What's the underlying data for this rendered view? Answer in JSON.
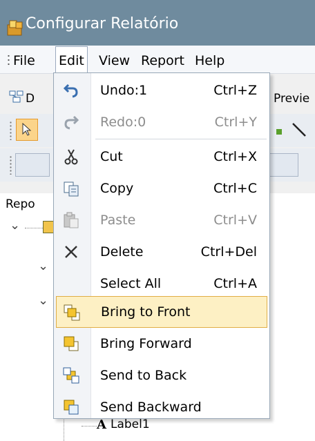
{
  "window": {
    "title": "Configurar Relatório",
    "title_icon": "report-config-icon"
  },
  "menubar": {
    "items": [
      {
        "label": "File"
      },
      {
        "label": "Edit"
      },
      {
        "label": "View"
      },
      {
        "label": "Report"
      },
      {
        "label": "Help"
      }
    ]
  },
  "toolbar": {
    "tab_partial_left": "D",
    "tab_partial_right": "Previe"
  },
  "tree": {
    "header_partial": "Repo",
    "bottom_item": "Label1"
  },
  "edit_menu": {
    "items": [
      {
        "label": "Undo:1",
        "shortcut": "Ctrl+Z",
        "icon": "undo-icon",
        "enabled": true
      },
      {
        "label": "Redo:0",
        "shortcut": "Ctrl+Y",
        "icon": "redo-icon",
        "enabled": false
      },
      {
        "label": "Cut",
        "shortcut": "Ctrl+X",
        "icon": "cut-icon",
        "enabled": true
      },
      {
        "label": "Copy",
        "shortcut": "Ctrl+C",
        "icon": "copy-icon",
        "enabled": true
      },
      {
        "label": "Paste",
        "shortcut": "Ctrl+V",
        "icon": "paste-icon",
        "enabled": false
      },
      {
        "label": "Delete",
        "shortcut": "Ctrl+Del",
        "icon": "delete-icon",
        "enabled": true
      },
      {
        "label": "Select All",
        "shortcut": "Ctrl+A",
        "icon": "",
        "enabled": true
      },
      {
        "label": "Bring to Front",
        "shortcut": "",
        "icon": "bring-to-front-icon",
        "enabled": true,
        "highlighted": true
      },
      {
        "label": "Bring Forward",
        "shortcut": "",
        "icon": "bring-forward-icon",
        "enabled": true
      },
      {
        "label": "Send to Back",
        "shortcut": "",
        "icon": "send-to-back-icon",
        "enabled": true
      },
      {
        "label": "Send Backward",
        "shortcut": "",
        "icon": "send-backward-icon",
        "enabled": true
      }
    ]
  },
  "colors": {
    "titlebar": "#6f8b9e",
    "highlight_bg": "#fdf0c4",
    "highlight_border": "#e0ad44"
  }
}
